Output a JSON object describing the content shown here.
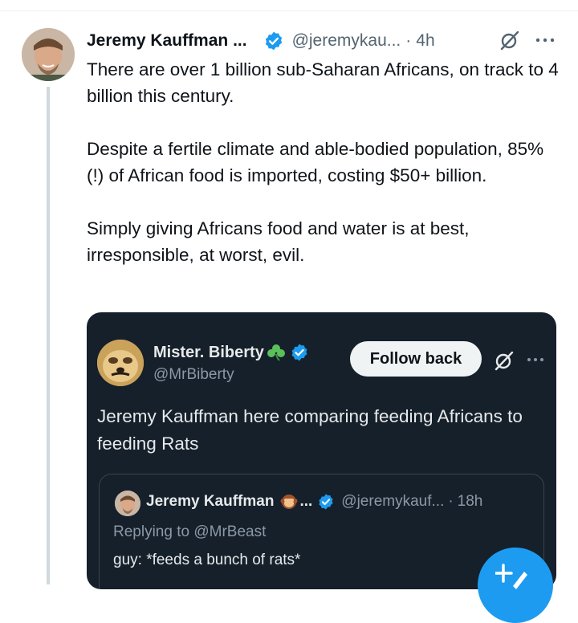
{
  "colors": {
    "accent": "#1d9bf0",
    "text_primary": "#0f1419",
    "text_secondary": "#536471",
    "quote_bg": "#15202b",
    "quote_text": "#e7e9ea",
    "quote_secondary": "#8b98a5"
  },
  "tweet": {
    "author_name": "Jeremy Kauffman ...",
    "handle": "@jeremykau...",
    "separator": "·",
    "time": "4h",
    "icons": {
      "verified": "verified-badge-icon",
      "grok": "grok-icon",
      "more": "more-options-icon"
    },
    "paragraphs": [
      "There are over 1 billion sub-Saharan Africans, on track to 4 billion this century.",
      "Despite a fertile climate and able-bodied population, 85% (!) of African food is imported, costing $50+ billion.",
      "Simply giving Africans food and water is at best, irresponsible, at worst, evil."
    ]
  },
  "quote": {
    "author_name": "Mister. Biberty",
    "handle": "@MrBiberty",
    "follow_label": "Follow back",
    "text": "Jeremy Kauffman here comparing feeding Africans to feeding Rats",
    "icons": {
      "clover": "shamrock-icon",
      "verified": "verified-badge-icon",
      "grok": "grok-icon",
      "more": "more-options-icon"
    }
  },
  "nested_quote": {
    "author_name": "Jeremy Kauffman",
    "ellipsis": "...",
    "handle": "@jeremykauf...",
    "separator": "·",
    "time": "18h",
    "replying": "Replying to @MrBeast",
    "text": "guy: *feeds a bunch of rats*",
    "icons": {
      "emoji": "monkey-emoji-icon",
      "verified": "verified-badge-icon"
    }
  },
  "compose_button": {
    "icon": "compose-post-icon"
  }
}
